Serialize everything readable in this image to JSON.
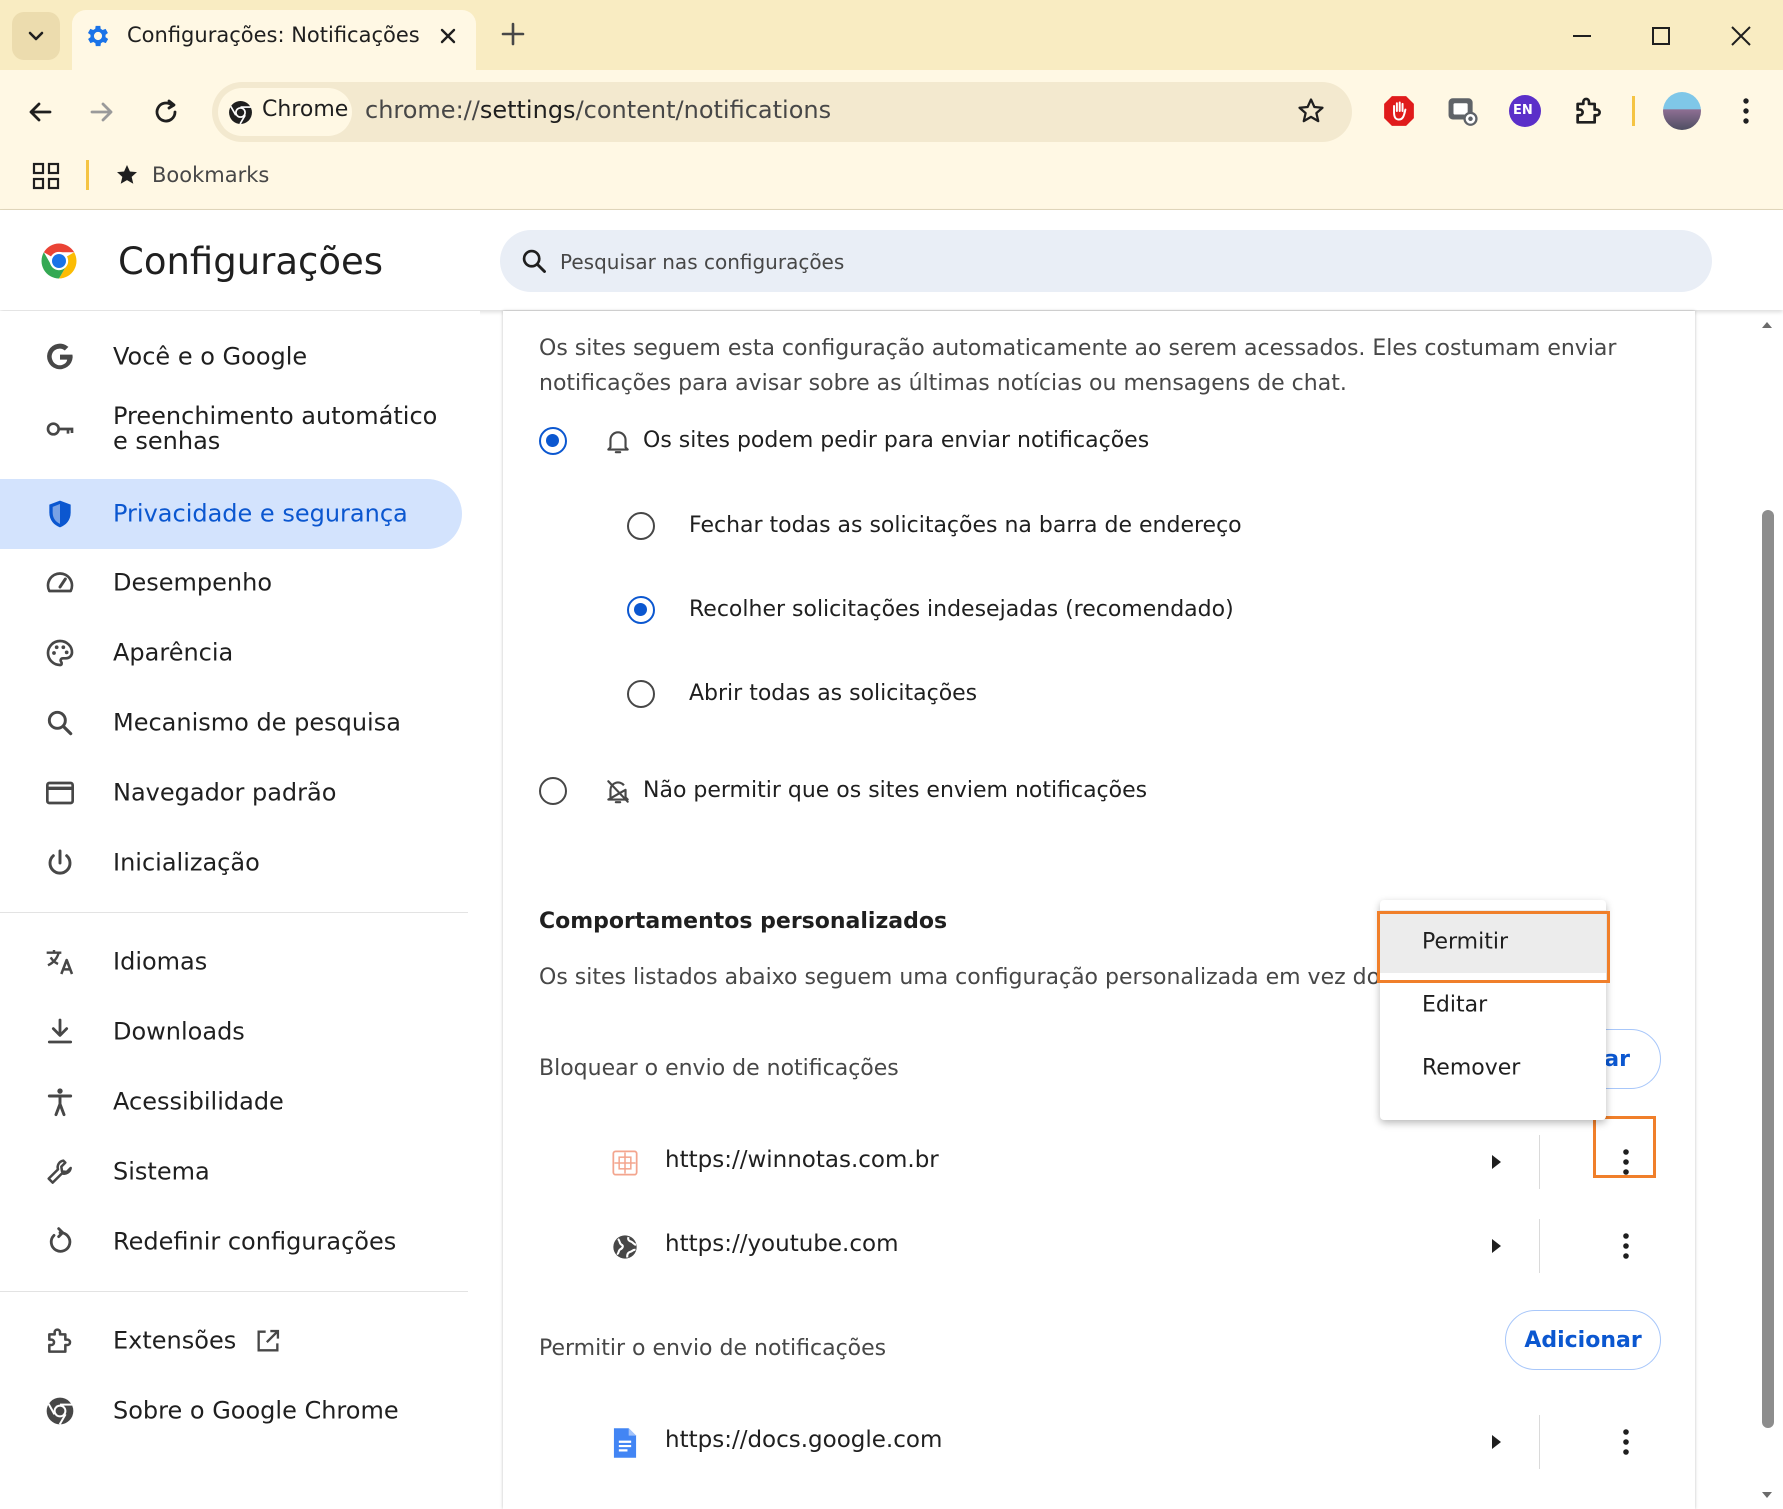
{
  "browser": {
    "tab_title": "Configurações: Notificações",
    "chrome_chip": "Chrome",
    "url_scheme": "chrome://",
    "url_host": "settings",
    "url_path": "/content/notifications",
    "profile_badge": "EN",
    "bookmarks_label": "Bookmarks"
  },
  "header": {
    "title": "Configurações",
    "search_placeholder": "Pesquisar nas configurações"
  },
  "sidebar": {
    "items": [
      {
        "label": "Você e o Google",
        "icon": "google-g-icon"
      },
      {
        "label": "Preenchimento automático e senhas",
        "icon": "key-icon"
      },
      {
        "label": "Privacidade e segurança",
        "icon": "shield-icon",
        "active": true
      },
      {
        "label": "Desempenho",
        "icon": "speedometer-icon"
      },
      {
        "label": "Aparência",
        "icon": "palette-icon"
      },
      {
        "label": "Mecanismo de pesquisa",
        "icon": "search-icon"
      },
      {
        "label": "Navegador padrão",
        "icon": "browser-window-icon"
      },
      {
        "label": "Inicialização",
        "icon": "power-icon"
      },
      {
        "label": "Idiomas",
        "icon": "translate-icon"
      },
      {
        "label": "Downloads",
        "icon": "download-icon"
      },
      {
        "label": "Acessibilidade",
        "icon": "accessibility-icon"
      },
      {
        "label": "Sistema",
        "icon": "wrench-icon"
      },
      {
        "label": "Redefinir configurações",
        "icon": "reset-icon"
      },
      {
        "label": "Extensões",
        "icon": "puzzle-icon"
      },
      {
        "label": "Sobre o Google Chrome",
        "icon": "chrome-icon"
      }
    ]
  },
  "main": {
    "intro": "Os sites seguem esta configuração automaticamente ao serem acessados. Eles costumam enviar notificações para avisar sobre as últimas notícias ou mensagens de chat.",
    "option_allow_ask": "Os sites podem pedir para enviar notificações",
    "sub_options": [
      "Fechar todas as solicitações na barra de endereço",
      "Recolher solicitações indesejadas (recomendado)",
      "Abrir todas as solicitações"
    ],
    "option_block": "Não permitir que os sites enviem notificações",
    "custom_title": "Comportamentos personalizados",
    "custom_desc": "Os sites listados abaixo seguem uma configuração personalizada em vez do padrão",
    "block_section": "Bloquear o envio de notificações",
    "block_add_partial": "nar",
    "blocked_sites": [
      "https://winnotas.com.br",
      "https://youtube.com"
    ],
    "allow_section": "Permitir o envio de notificações",
    "allow_add": "Adicionar",
    "allowed_sites": [
      "https://docs.google.com"
    ]
  },
  "context_menu": {
    "items": [
      "Permitir",
      "Editar",
      "Remover"
    ]
  },
  "colors": {
    "accent": "#0b57d0",
    "highlight": "#f07f2a",
    "tabstrip": "#f9ecc2"
  }
}
